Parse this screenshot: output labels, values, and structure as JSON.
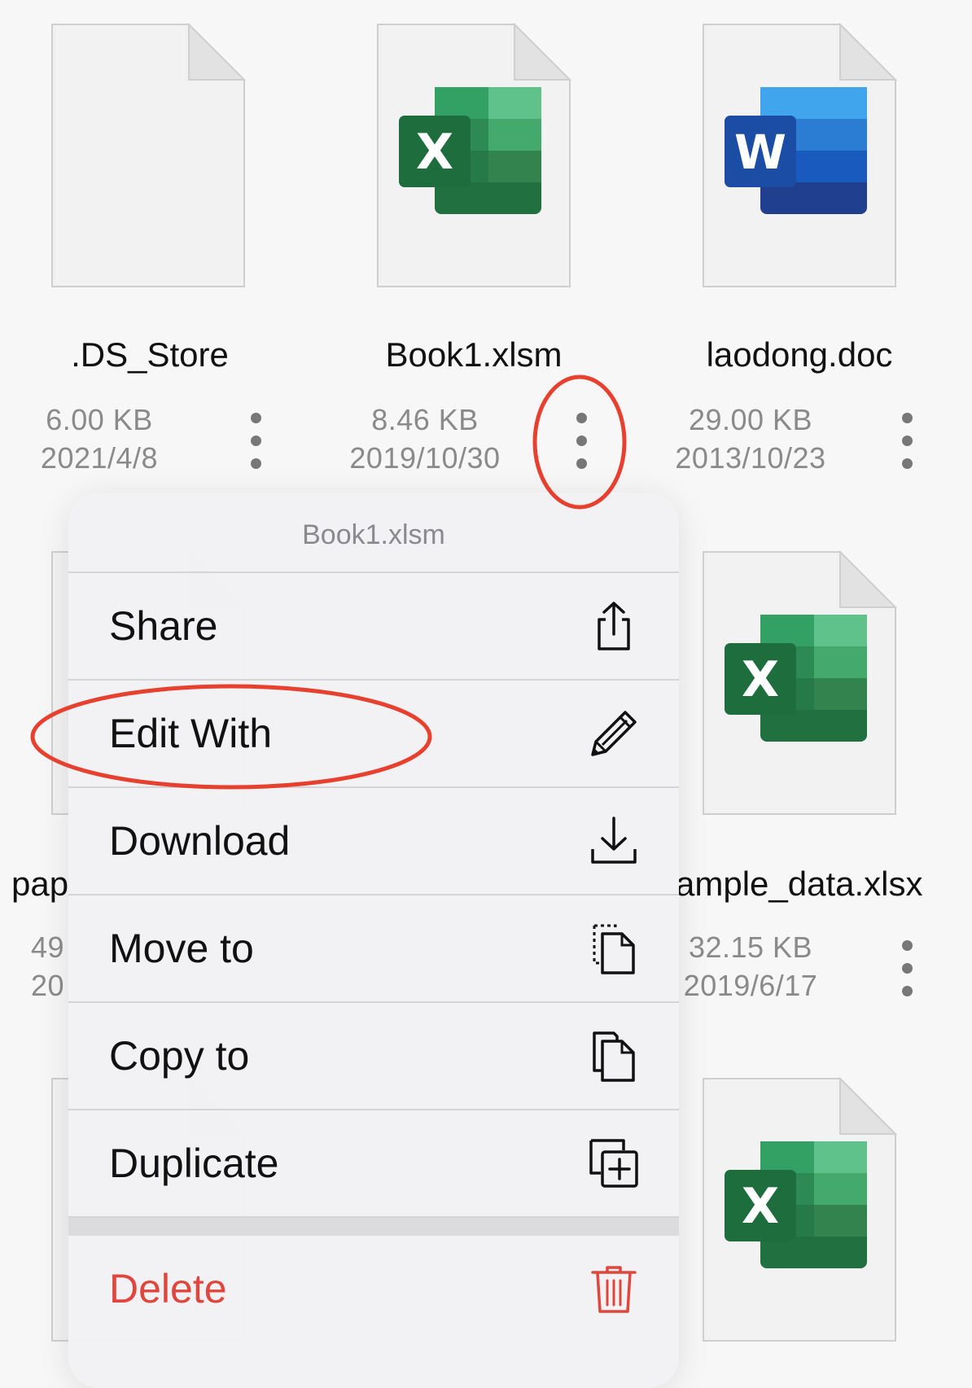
{
  "files": [
    {
      "name": ".DS_Store",
      "size": "6.00 KB",
      "date": "2021/4/8",
      "icon": "blank-document-icon"
    },
    {
      "name": "Book1.xlsm",
      "size": "8.46 KB",
      "date": "2019/10/30",
      "icon": "excel-icon"
    },
    {
      "name": "laodong.doc",
      "size": "29.00 KB",
      "date": "2013/10/23",
      "icon": "word-icon"
    },
    {
      "name": "pap",
      "size": "49",
      "date": "20",
      "icon": "blank-document-icon"
    },
    {
      "name": "ample_data.xlsx",
      "size": "32.15 KB",
      "date": "2019/6/17",
      "icon": "excel-icon"
    }
  ],
  "menu": {
    "title": "Book1.xlsm",
    "items": [
      {
        "label": "Share",
        "icon": "share-icon"
      },
      {
        "label": "Edit With",
        "icon": "pencil-icon"
      },
      {
        "label": "Download",
        "icon": "download-icon"
      },
      {
        "label": "Move to",
        "icon": "move-icon"
      },
      {
        "label": "Copy to",
        "icon": "copy-icon"
      },
      {
        "label": "Duplicate",
        "icon": "duplicate-icon"
      }
    ],
    "destructive": {
      "label": "Delete",
      "icon": "trash-icon"
    }
  },
  "colors": {
    "destructive": "#e0463c",
    "annotation": "#e8402e",
    "excel_green": "#217346",
    "word_blue": "#2b579a"
  }
}
